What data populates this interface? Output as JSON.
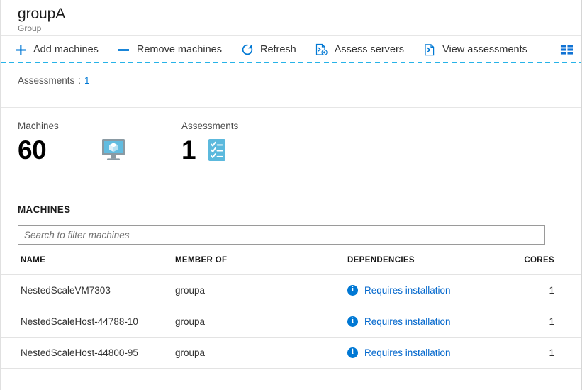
{
  "header": {
    "title": "groupA",
    "subtitle": "Group"
  },
  "toolbar": {
    "items": [
      {
        "label": "Add machines",
        "icon": "plus-icon"
      },
      {
        "label": "Remove machines",
        "icon": "minus-icon"
      },
      {
        "label": "Refresh",
        "icon": "refresh-icon"
      },
      {
        "label": "Assess servers",
        "icon": "assess-servers-icon"
      },
      {
        "label": "View assessments",
        "icon": "view-assessments-icon"
      }
    ],
    "columns_icon": "columns-grid-icon"
  },
  "filters": {
    "assessments_label": "Assessments",
    "separator": ":",
    "assessments_value": "1"
  },
  "stats": [
    {
      "label": "Machines",
      "value": "60",
      "icon": "monitor-server-icon"
    },
    {
      "label": "Assessments",
      "value": "1",
      "icon": "checklist-icon"
    }
  ],
  "machines": {
    "section_title": "MACHINES",
    "search_placeholder": "Search to filter machines",
    "search_value": "",
    "columns": [
      "NAME",
      "MEMBER OF",
      "DEPENDENCIES",
      "CORES"
    ],
    "rows": [
      {
        "name": "NestedScaleVM7303",
        "member_of": "groupa",
        "dependencies": "Requires installation",
        "dependencies_icon": "info-icon",
        "cores": "1"
      },
      {
        "name": "NestedScaleHost-44788-10",
        "member_of": "groupa",
        "dependencies": "Requires installation",
        "dependencies_icon": "info-icon",
        "cores": "1"
      },
      {
        "name": "NestedScaleHost-44800-95",
        "member_of": "groupa",
        "dependencies": "Requires installation",
        "dependencies_icon": "info-icon",
        "cores": "1"
      }
    ]
  },
  "colors": {
    "accent": "#0078d4",
    "link": "#0066cc",
    "dashed_rule": "#27b3e8",
    "monitor_screen": "#62bce0",
    "checklist_bg": "#5cb9dd"
  }
}
